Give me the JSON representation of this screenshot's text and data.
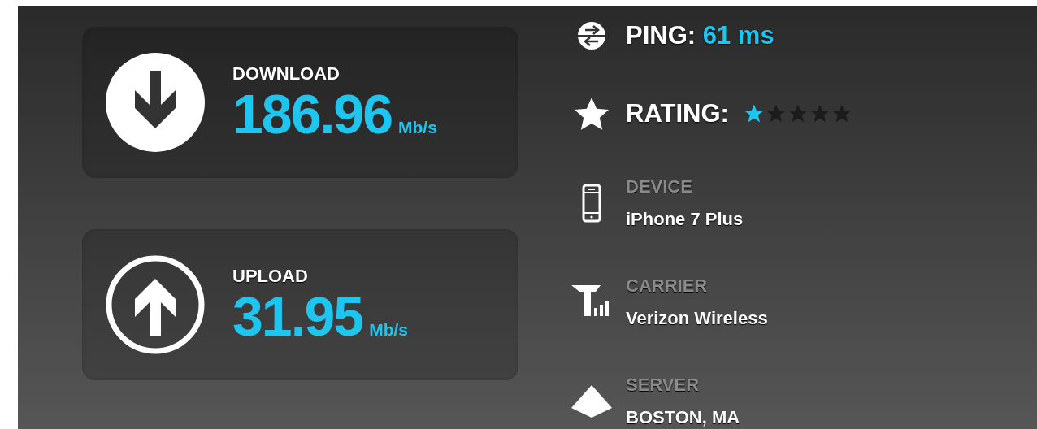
{
  "speeds": [
    {
      "kind": "download",
      "label": "DOWNLOAD",
      "value": "186.96",
      "unit": "Mb/s"
    },
    {
      "kind": "upload",
      "label": "UPLOAD",
      "value": "31.95",
      "unit": "Mb/s"
    }
  ],
  "ping": {
    "label": "PING:",
    "value": "61 ms"
  },
  "rating": {
    "label": "RATING:",
    "stars": 1
  },
  "details": [
    {
      "label": "DEVICE",
      "value": "iPhone 7 Plus"
    },
    {
      "label": "CARRIER",
      "value": "Verizon Wireless"
    },
    {
      "label": "SERVER",
      "value": "BOSTON, MA"
    }
  ]
}
